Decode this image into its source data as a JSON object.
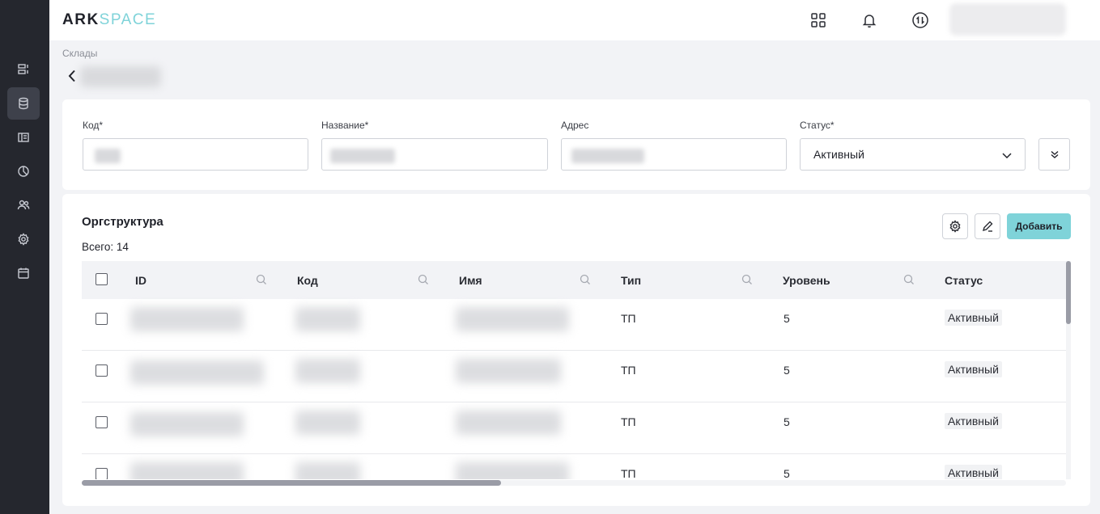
{
  "app": {
    "logo_part1": "ARK",
    "logo_part2": "SPACE"
  },
  "breadcrumb": "Склады",
  "filters": {
    "code_label": "Код*",
    "name_label": "Название*",
    "address_label": "Адрес",
    "status_label": "Статус*",
    "status_value": "Активный"
  },
  "table_card": {
    "title": "Оргструктура",
    "total": "Всего: 14",
    "add_label": "Добавить",
    "columns": [
      "ID",
      "Код",
      "Имя",
      "Тип",
      "Уровень",
      "Статус"
    ],
    "rows": [
      {
        "type": "ТП",
        "level": "5",
        "status": "Активный"
      },
      {
        "type": "ТП",
        "level": "5",
        "status": "Активный"
      },
      {
        "type": "ТП",
        "level": "5",
        "status": "Активный"
      },
      {
        "type": "ТП",
        "level": "5",
        "status": "Активный"
      }
    ]
  },
  "colors": {
    "accent": "#7fd3d9",
    "sidebar": "#25272e"
  }
}
